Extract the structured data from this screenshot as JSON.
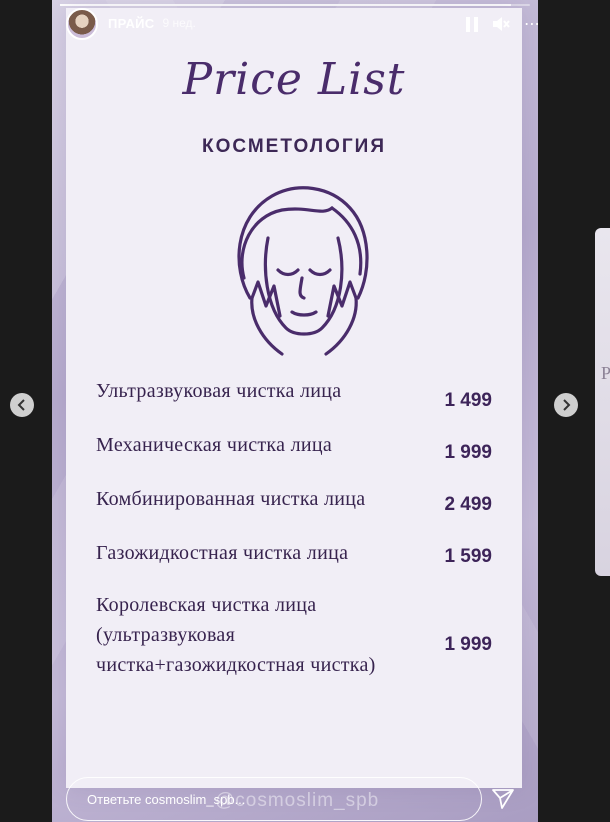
{
  "story": {
    "username": "ПРАЙС",
    "time_ago": "9 нед.",
    "progress": 0.96
  },
  "card": {
    "title": "Price List",
    "subtitle": "КОСМЕТОЛОГИЯ",
    "items": [
      {
        "name": "Ультразвуковая чистка лица",
        "price": "1 499"
      },
      {
        "name": "Механическая чистка лица",
        "price": "1 999"
      },
      {
        "name": "Комбинированная чистка лица",
        "price": "2 499"
      },
      {
        "name": "Газожидкостная чистка лица",
        "price": "1 599"
      },
      {
        "name": "Королевская чистка лица (ультразвуковая чистка+газожидкостная чистка)",
        "price": "1 999"
      }
    ]
  },
  "reply": {
    "placeholder": "Ответьте cosmoslim_spb...",
    "watermark": "@cosmoslim_spb"
  },
  "icons": {
    "pause": "pause-icon",
    "mute": "volume-muted-icon",
    "prev": "chevron-left-icon",
    "next": "chevron-right-icon",
    "send": "send-icon"
  },
  "colors": {
    "accent": "#4a2c6b",
    "card_bg": "#f1eef6",
    "story_bg": "#b7acce"
  }
}
